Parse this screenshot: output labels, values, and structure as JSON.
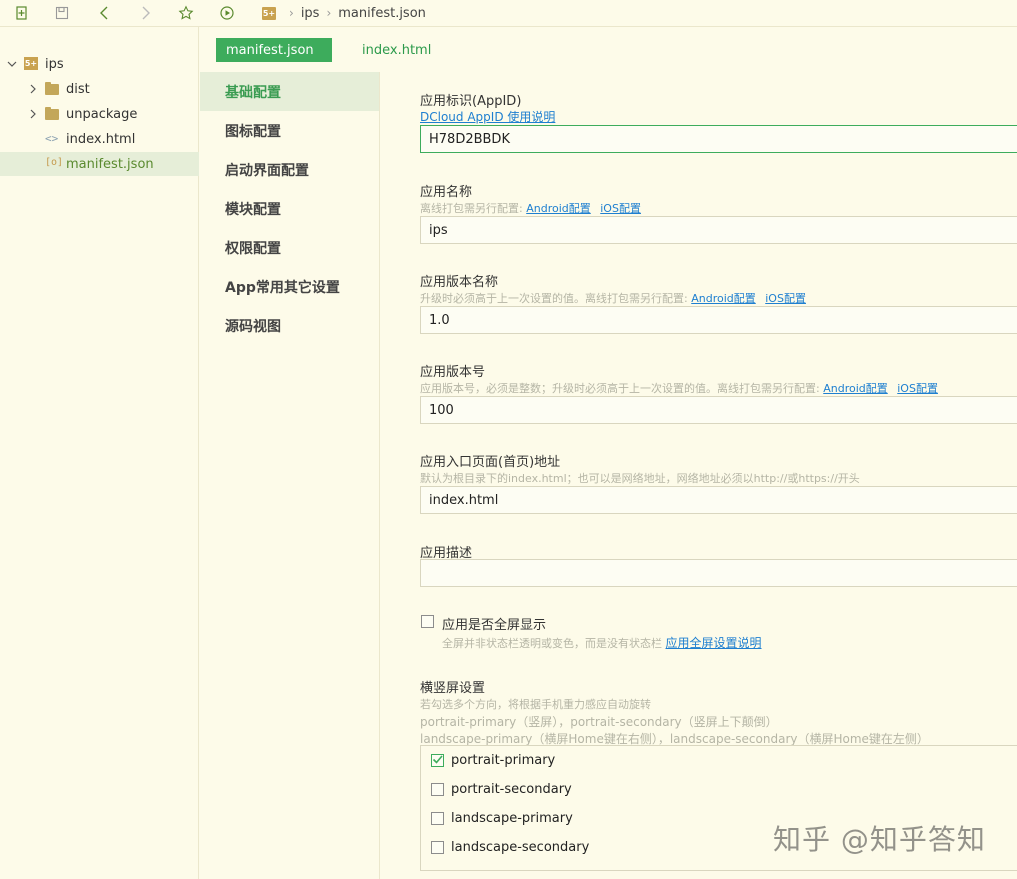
{
  "toolbar": {
    "breadcrumb": [
      "ips",
      "manifest.json"
    ],
    "logo_text": "5+"
  },
  "tree": {
    "items": [
      {
        "label": "ips",
        "icon": "project-logo-icon",
        "expanded": true
      },
      {
        "label": "dist",
        "icon": "folder-icon"
      },
      {
        "label": "unpackage",
        "icon": "folder-icon"
      },
      {
        "label": "index.html",
        "icon": "code-icon"
      },
      {
        "label": "manifest.json",
        "icon": "json-file-icon",
        "selected": true
      }
    ]
  },
  "tabs": [
    {
      "label": "manifest.json",
      "active": true
    },
    {
      "label": "index.html",
      "active": false
    }
  ],
  "nav": {
    "items": [
      "基础配置",
      "图标配置",
      "启动界面配置",
      "模块配置",
      "权限配置",
      "App常用其它设置",
      "源码视图"
    ]
  },
  "form": {
    "appid": {
      "label": "应用标识(AppID)",
      "link": "DCloud AppID 使用说明",
      "value": "H78D2BBDK"
    },
    "name": {
      "label": "应用名称",
      "hint": "离线打包需另行配置:",
      "android": "Android配置",
      "ios": "iOS配置",
      "value": "ips"
    },
    "version_name": {
      "label": "应用版本名称",
      "hint": "升级时必须高于上一次设置的值。离线打包需另行配置:",
      "android": "Android配置",
      "ios": "iOS配置",
      "value": "1.0"
    },
    "version_code": {
      "label": "应用版本号",
      "hint": "应用版本号，必须是整数；升级时必须高于上一次设置的值。离线打包需另行配置:",
      "android": "Android配置",
      "ios": "iOS配置",
      "value": "100"
    },
    "entry": {
      "label": "应用入口页面(首页)地址",
      "hint": "默认为根目录下的index.html；也可以是网络地址，网络地址必须以http://或https://开头",
      "value": "index.html"
    },
    "description": {
      "label": "应用描述",
      "value": ""
    },
    "fullscreen": {
      "label": "应用是否全屏显示",
      "hint": "全屏并非状态栏透明或变色，而是没有状态栏",
      "link": "应用全屏设置说明",
      "checked": false
    },
    "orientation": {
      "label": "横竖屏设置",
      "hint1": "若勾选多个方向，将根据手机重力感应自动旋转",
      "hint2": "portrait-primary（竖屏），portrait-secondary（竖屏上下颠倒）",
      "hint3": "landscape-primary（横屏Home键在右侧），landscape-secondary（横屏Home键在左侧）",
      "options": [
        {
          "label": "portrait-primary",
          "checked": true
        },
        {
          "label": "portrait-secondary",
          "checked": false
        },
        {
          "label": "landscape-primary",
          "checked": false
        },
        {
          "label": "landscape-secondary",
          "checked": false
        }
      ]
    }
  },
  "watermark": "知乎 @知乎答知",
  "colors": {
    "accent": "#3dac5c",
    "link": "#1e7fd0",
    "background": "#fdfbe9"
  }
}
